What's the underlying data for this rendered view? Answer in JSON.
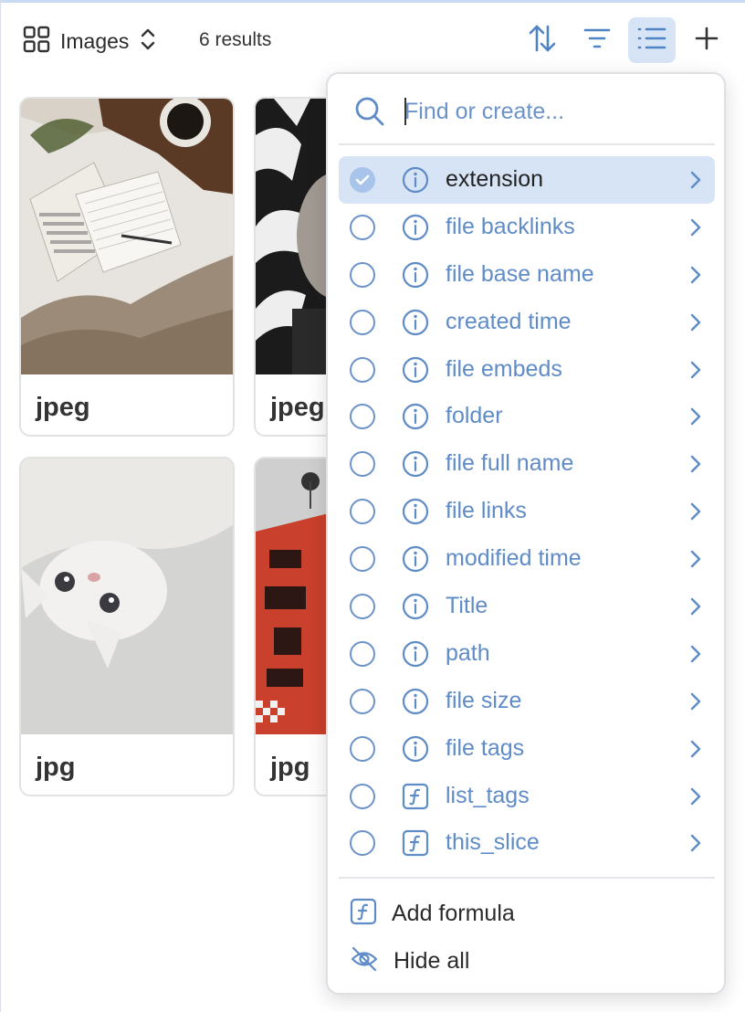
{
  "toolbar": {
    "view_name": "Images",
    "result_count": "6 results",
    "icons": {
      "view": "grid-icon",
      "switch": "chevron-up-down-icon",
      "sort": "sort-arrows-icon",
      "filter": "filter-icon",
      "properties": "list-icon",
      "add": "plus-icon"
    },
    "properties_active": true
  },
  "cards": [
    {
      "caption": "jpeg",
      "image": "bed-notebook-coffee-photo"
    },
    {
      "caption": "jpeg",
      "image": "zebra-pattern-photo"
    },
    {
      "caption": "jpg",
      "image": "white-kitten-photo"
    },
    {
      "caption": "jpg",
      "image": "red-banner-photo"
    }
  ],
  "properties_menu": {
    "search": {
      "placeholder": "Find or create..."
    },
    "items": [
      {
        "label": "extension",
        "kind": "info",
        "checked": true
      },
      {
        "label": "file backlinks",
        "kind": "info",
        "checked": false
      },
      {
        "label": "file base name",
        "kind": "info",
        "checked": false
      },
      {
        "label": "created time",
        "kind": "info",
        "checked": false
      },
      {
        "label": "file embeds",
        "kind": "info",
        "checked": false
      },
      {
        "label": "folder",
        "kind": "info",
        "checked": false
      },
      {
        "label": "file full name",
        "kind": "info",
        "checked": false
      },
      {
        "label": "file links",
        "kind": "info",
        "checked": false
      },
      {
        "label": "modified time",
        "kind": "info",
        "checked": false
      },
      {
        "label": "Title",
        "kind": "info",
        "checked": false
      },
      {
        "label": "path",
        "kind": "info",
        "checked": false
      },
      {
        "label": "file size",
        "kind": "info",
        "checked": false
      },
      {
        "label": "file tags",
        "kind": "info",
        "checked": false
      },
      {
        "label": "list_tags",
        "kind": "formula",
        "checked": false
      },
      {
        "label": "this_slice",
        "kind": "formula",
        "checked": false
      }
    ],
    "footer": {
      "add_formula": "Add formula",
      "hide_all": "Hide all"
    }
  },
  "colors": {
    "accent": "#5f8cc7",
    "active_bg": "#d6e4f6",
    "check_fill": "#a9c4ea",
    "text": "#222222"
  }
}
